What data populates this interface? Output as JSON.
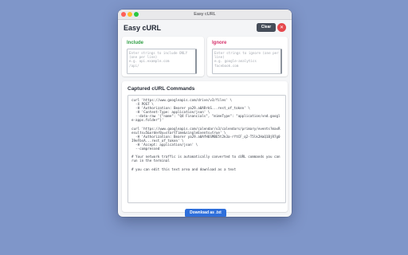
{
  "window": {
    "title": "Easy cURL",
    "traffic_lights": {
      "close_color": "#fe5f57",
      "minimize_color": "#febc2e",
      "maximize_color": "#28c840"
    }
  },
  "header": {
    "title": "Easy cURL",
    "clear_label": "Clear",
    "close_glyph": "✕",
    "close_icon": "close-icon"
  },
  "include": {
    "label": "Include",
    "placeholder": "Enter strings to include ONLY (one per line)\ne.g. api.example.com\n/api/",
    "color": "#2f9e44"
  },
  "ignore": {
    "label": "Ignore",
    "placeholder": "Enter strings to ignore (one per line)\ne.g. google-analytics\nfacebook.com",
    "color": "#d6336c"
  },
  "commands": {
    "title": "Captured cURL Commands",
    "text": "curl 'https://www.googleapis.com/drive/v3/files' \\\n  -X POST \\\n  -H 'Authorization: Bearer ya29.a0ARrkS...rest_of_token' \\\n  -H 'Content-Type: application/json' \\\n  --data-raw '{\"name\": \"Q4 Financials\", \"mimeType\": \"application/vnd.google-apps.folder\"}'\n\ncurl 'https://www.googleapis.com/calendar/v3/calendars/primary/events?maxResults=5&orderBy=startTime&singleEvents=true' \\\n  -H 'Authorization: Bearer ya29.a0AfH6SMBE5t2k3a-rYtCF_q2-T5lk2HaQ1BjR7g0I9eFbsA...rest_of_token' \\\n  -H 'Accept: application/json' \\\n  --compressed\n\n# Your network traffic is automatically converted to cURL commands you can run in the terminal\n\n# you can edit this text area and download as a text",
    "download_label": "Download as .txt",
    "download_color": "#2f6fdb"
  }
}
